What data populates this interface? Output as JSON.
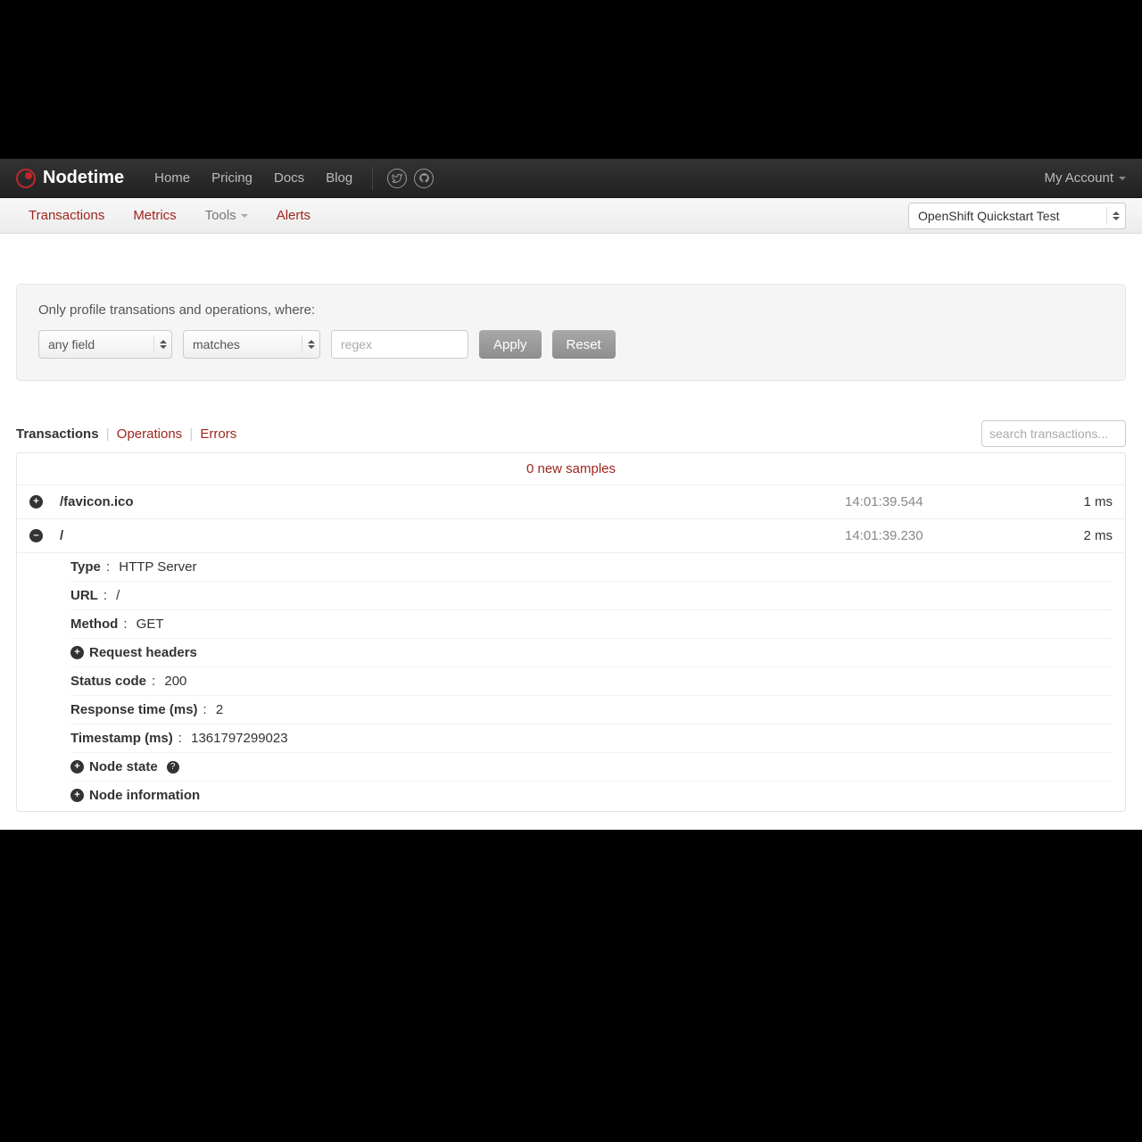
{
  "brand": "Nodetime",
  "nav": {
    "home": "Home",
    "pricing": "Pricing",
    "docs": "Docs",
    "blog": "Blog",
    "account": "My Account"
  },
  "subnav": {
    "transactions": "Transactions",
    "metrics": "Metrics",
    "tools": "Tools",
    "alerts": "Alerts",
    "project": "OpenShift Quickstart Test"
  },
  "filter": {
    "title": "Only profile transations and operations, where:",
    "field": "any field",
    "op": "matches",
    "regex_placeholder": "regex",
    "apply": "Apply",
    "reset": "Reset"
  },
  "tabs": {
    "transactions": "Transactions",
    "operations": "Operations",
    "errors": "Errors",
    "search_placeholder": "search transactions..."
  },
  "samples_bar": "0 new samples",
  "rows": [
    {
      "path": "/favicon.ico",
      "time": "14:01:39.544",
      "dur": "1 ms",
      "expanded": false
    },
    {
      "path": "/",
      "time": "14:01:39.230",
      "dur": "2 ms",
      "expanded": true
    }
  ],
  "details": {
    "type_label": "Type",
    "type_value": "HTTP Server",
    "url_label": "URL",
    "url_value": "/",
    "method_label": "Method",
    "method_value": "GET",
    "req_headers": "Request headers",
    "status_label": "Status code",
    "status_value": "200",
    "resp_label": "Response time (ms)",
    "resp_value": "2",
    "ts_label": "Timestamp (ms)",
    "ts_value": "1361797299023",
    "node_state": "Node state",
    "node_info": "Node information"
  }
}
